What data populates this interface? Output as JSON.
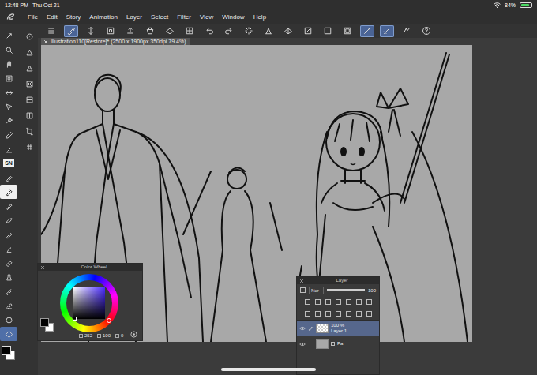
{
  "status_bar": {
    "time": "12:48 PM",
    "date": "Thu Oct 21",
    "battery": "84%",
    "battery_level": 0.84,
    "charging": true
  },
  "menu": {
    "items": [
      "File",
      "Edit",
      "Story",
      "Animation",
      "Layer",
      "Select",
      "Filter",
      "View",
      "Window",
      "Help"
    ]
  },
  "toolbar": {
    "buttons": [
      {
        "selected": false
      },
      {
        "selected": true
      },
      {
        "selected": false
      },
      {
        "selected": false
      },
      {
        "selected": false
      },
      {
        "selected": false
      },
      {
        "selected": false
      },
      {
        "selected": false
      },
      {
        "selected": false
      },
      {
        "selected": false
      },
      {
        "selected": false
      },
      {
        "selected": false
      },
      {
        "selected": false
      },
      {
        "selected": false
      },
      {
        "selected": false
      },
      {
        "selected": false
      },
      {
        "selected": true
      },
      {
        "selected": true
      },
      {
        "selected": false
      },
      {
        "selected": false
      }
    ]
  },
  "tools": {
    "primary": [
      {
        "kind": "icon",
        "selected": false
      },
      {
        "kind": "icon",
        "selected": false
      },
      {
        "kind": "icon",
        "selected": false
      },
      {
        "kind": "icon",
        "selected": false
      },
      {
        "kind": "icon",
        "selected": false
      },
      {
        "kind": "icon",
        "selected": false
      },
      {
        "kind": "icon",
        "selected": false
      },
      {
        "kind": "icon",
        "selected": false
      },
      {
        "kind": "icon",
        "selected": false
      },
      {
        "kind": "text",
        "label": "SN",
        "selected": false
      },
      {
        "kind": "icon",
        "selected": false
      },
      {
        "kind": "icon",
        "selected": true
      },
      {
        "kind": "icon",
        "selected": false
      },
      {
        "kind": "icon",
        "selected": false
      },
      {
        "kind": "icon",
        "selected": false
      },
      {
        "kind": "icon",
        "selected": false
      },
      {
        "kind": "icon",
        "selected": false
      },
      {
        "kind": "icon",
        "selected": false
      },
      {
        "kind": "icon",
        "selected": false
      },
      {
        "kind": "icon",
        "selected": false
      },
      {
        "kind": "icon",
        "selected": false
      },
      {
        "kind": "icon",
        "selected": true
      }
    ],
    "secondary": [
      {
        "selected": false
      },
      {
        "selected": false
      },
      {
        "selected": false
      },
      {
        "selected": false
      },
      {
        "selected": false
      },
      {
        "selected": false
      },
      {
        "selected": false
      },
      {
        "selected": false
      }
    ]
  },
  "colors": {
    "swatches": [
      {
        "name": "main",
        "color": "#000000",
        "selected": true
      },
      {
        "name": "sub",
        "color": "#ffffff",
        "selected": false
      }
    ]
  },
  "document_tab": {
    "title": "Illustration110[Restore]* (2500 x 1900px 350dpi 79.4%)"
  },
  "color_wheel": {
    "title": "Color Wheel",
    "values": [
      "252",
      "100",
      "0"
    ],
    "hue_level": 0.7,
    "saturation_level": 1,
    "value_level": 0
  },
  "layer_panel": {
    "title": "Layer",
    "blend_mode": "Nor",
    "opacity": "100",
    "opacity_level": 1,
    "layers": [
      {
        "name": "Layer 1",
        "info": "100 %",
        "kind": "raster",
        "visible": true,
        "selected": true
      },
      {
        "name": "Pa",
        "kind": "paper",
        "visible": true,
        "selected": false
      }
    ]
  }
}
